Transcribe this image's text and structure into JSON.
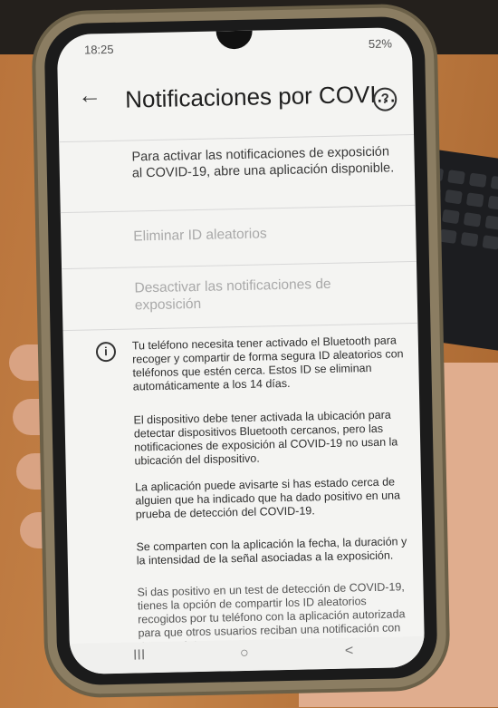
{
  "status_bar": {
    "time": "18:25",
    "battery": "52%"
  },
  "app_bar": {
    "title": "Notificaciones por COVI...",
    "back_icon": "arrow-back-icon",
    "help_icon": "help-circle-icon"
  },
  "intro_text": "Para activar las notificaciones de exposición al COVID-19, abre una aplicación disponible.",
  "actions": {
    "delete_ids": "Eliminar ID aleatorios",
    "disable": "Desactivar las notificaciones de exposición"
  },
  "info": {
    "icon": "info-circle-icon",
    "paragraphs": [
      "Tu teléfono necesita tener activado el Bluetooth para recoger y compartir de forma segura ID aleatorios con teléfonos que estén cerca. Estos ID se eliminan automáticamente a los 14 días.",
      "El dispositivo debe tener activada la ubicación para detectar dispositivos Bluetooth cercanos, pero las notificaciones de exposición al COVID-19 no usan la ubicación del dispositivo.",
      "La aplicación puede avisarte si has estado cerca de alguien que ha indicado que ha dado positivo en una prueba de detección del COVID-19.",
      "Se comparten con la aplicación la fecha, la duración y la intensidad de la señal asociadas a la exposición.",
      "Si das positivo en un test de detección de COVID-19, tienes la opción de compartir los ID aleatorios recogidos por tu teléfono con la aplicación autorizada para que otros usuarios reciban una notificación con datos anónimos."
    ]
  },
  "nav_bar": {
    "recents": "III",
    "home": "○",
    "back": "<"
  }
}
